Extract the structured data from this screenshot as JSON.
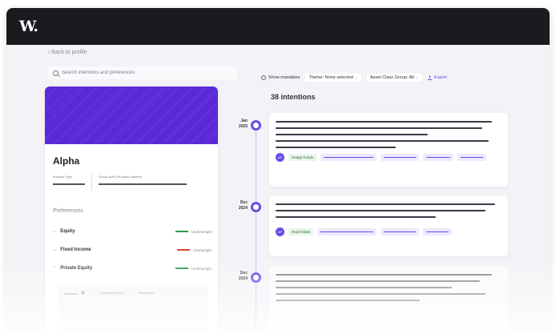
{
  "header": {
    "logo": "W."
  },
  "nav": {
    "back_label": "‹ Back to profile"
  },
  "search": {
    "placeholder": "Search intentions and preferences"
  },
  "toolbar": {
    "show_mandates": "Show mandates",
    "theme_filter": "Theme: None selected",
    "asset_class_filter": "Asset Class Group: All",
    "export_label": "Export"
  },
  "intentions": {
    "count_label": "38 intentions"
  },
  "profile": {
    "name": "Alpha",
    "investor_type_label": "Investor Type",
    "group_aum_label": "Group AUM (All asset classes)",
    "preferences_title": "Preferences",
    "preferences": [
      {
        "label": "Equity",
        "weight": "Underweight",
        "color": "#2e9a4a"
      },
      {
        "label": "Fixed Income",
        "weight": "Overweight",
        "color": "#e0453a"
      },
      {
        "label": "Private Equity",
        "weight": "Underweight",
        "color": "#2e9a4a"
      }
    ],
    "sub_columns": [
      "Mandates",
      "Ticket size (USD)",
      "Fund count"
    ]
  },
  "timeline": {
    "entries": [
      {
        "date_month": "Jan",
        "date_year": "2025",
        "tag": "Hedge Funds",
        "avatar": "AP"
      },
      {
        "date_month": "Dec",
        "date_year": "2024",
        "tag": "Real Estate",
        "avatar": "AP"
      },
      {
        "date_month": "Dec",
        "date_year": "2024",
        "tag": "",
        "avatar": ""
      }
    ]
  },
  "colors": {
    "accent": "#6a4be8",
    "topbar": "#1b1b1f",
    "banner": "#5a2ad6"
  }
}
